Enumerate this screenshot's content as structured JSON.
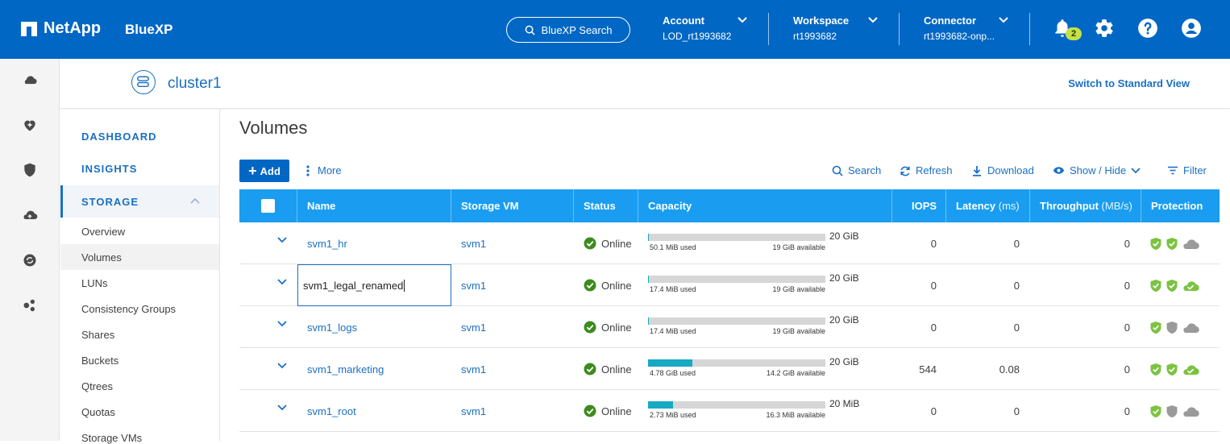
{
  "header": {
    "brand": "NetApp",
    "product": "BlueXP",
    "search_label": "BlueXP Search",
    "account": {
      "label": "Account",
      "value": "LOD_rt1993682"
    },
    "workspace": {
      "label": "Workspace",
      "value": "rt1993682"
    },
    "connector": {
      "label": "Connector",
      "value": "rt1993682-onp..."
    },
    "notification_count": "2"
  },
  "cluster": {
    "name": "cluster1",
    "switch_view": "Switch to Standard View"
  },
  "subnav": {
    "dashboard": "DASHBOARD",
    "insights": "INSIGHTS",
    "storage": "STORAGE",
    "items": [
      "Overview",
      "Volumes",
      "LUNs",
      "Consistency Groups",
      "Shares",
      "Buckets",
      "Qtrees",
      "Quotas",
      "Storage VMs"
    ]
  },
  "page": {
    "title": "Volumes",
    "add_label": "Add",
    "more_label": "More",
    "tools": {
      "search": "Search",
      "refresh": "Refresh",
      "download": "Download",
      "show_hide": "Show / Hide",
      "filter": "Filter"
    }
  },
  "table": {
    "headers": {
      "name": "Name",
      "svm": "Storage VM",
      "status": "Status",
      "capacity": "Capacity",
      "iops": "IOPS",
      "latency": "Latency",
      "latency_unit": "(ms)",
      "throughput": "Throughput",
      "throughput_unit": "(MB/s)",
      "protection": "Protection"
    },
    "rows": [
      {
        "name": "svm1_hr",
        "svm": "svm1",
        "status": "Online",
        "used": "50.1 MiB used",
        "available": "19 GiB available",
        "total": "20 GiB",
        "used_fraction": 0.003,
        "iops": "0",
        "latency": "0",
        "throughput": "0",
        "protection": [
          "shield-check-green",
          "shield-check-green",
          "cloud-gray"
        ]
      },
      {
        "name": "svm1_legal_renamed",
        "svm": "svm1",
        "status": "Online",
        "used": "17.4 MiB used",
        "available": "19 GiB available",
        "total": "20 GiB",
        "used_fraction": 0.001,
        "iops": "0",
        "latency": "0",
        "throughput": "0",
        "protection": [
          "shield-check-green",
          "shield-check-green",
          "cloud-check-green"
        ],
        "editing": true
      },
      {
        "name": "svm1_logs",
        "svm": "svm1",
        "status": "Online",
        "used": "17.4 MiB used",
        "available": "19 GiB available",
        "total": "20 GiB",
        "used_fraction": 0.001,
        "iops": "0",
        "latency": "0",
        "throughput": "0",
        "protection": [
          "shield-check-green",
          "shield-gray",
          "cloud-gray"
        ]
      },
      {
        "name": "svm1_marketing",
        "svm": "svm1",
        "status": "Online",
        "used": "4.78 GiB used",
        "available": "14.2 GiB available",
        "total": "20 GiB",
        "used_fraction": 0.25,
        "iops": "544",
        "latency": "0.08",
        "throughput": "0",
        "protection": [
          "shield-check-green",
          "shield-check-green",
          "cloud-check-green"
        ]
      },
      {
        "name": "svm1_root",
        "svm": "svm1",
        "status": "Online",
        "used": "2.73 MiB used",
        "available": "16.3 MiB available",
        "total": "20 MiB",
        "used_fraction": 0.14,
        "iops": "0",
        "latency": "0",
        "throughput": "0",
        "protection": [
          "shield-check-green",
          "shield-gray",
          "cloud-gray"
        ]
      }
    ]
  },
  "colors": {
    "header_bg": "#0067c5",
    "table_header": "#1a9df0",
    "link": "#1a6fc4",
    "online_green": "#3d8b1f",
    "protect_green": "#7cc242",
    "capacity_fill": "#17a9c4"
  }
}
